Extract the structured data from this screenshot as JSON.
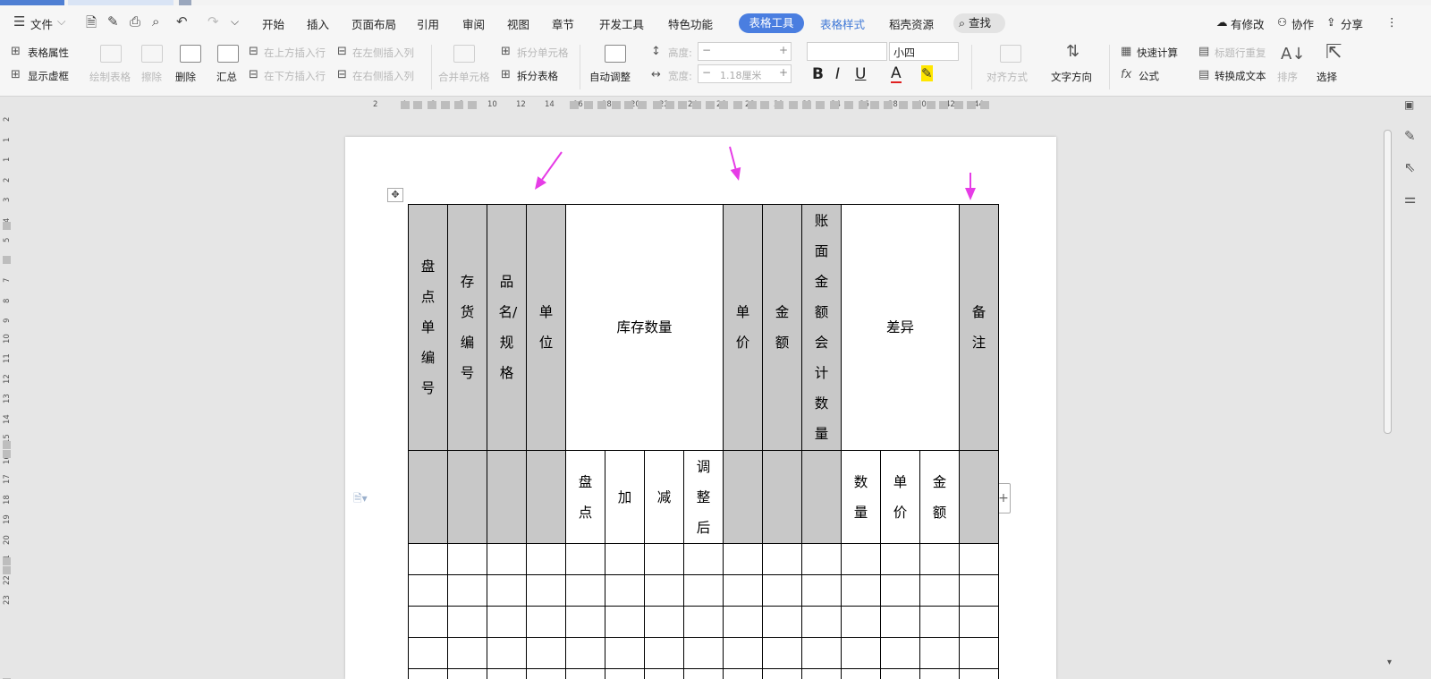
{
  "menu": {
    "file": "文件",
    "tabs": [
      "开始",
      "插入",
      "页面布局",
      "引用",
      "审阅",
      "视图",
      "章节",
      "开发工具",
      "特色功能"
    ],
    "active_tab": "表格工具",
    "extra_tabs": [
      "表格样式",
      "稻壳资源"
    ],
    "search": "查找",
    "right": {
      "modified": "有修改",
      "collab": "协作",
      "share": "分享"
    }
  },
  "ribbon": {
    "table_props": "表格属性",
    "show_grid": "显示虚框",
    "draw_table": "绘制表格",
    "erase": "擦除",
    "delete": "删除",
    "summary": "汇总",
    "insert_above": "在上方插入行",
    "insert_below": "在下方插入行",
    "insert_left": "在左侧插入列",
    "insert_right": "在右侧插入列",
    "merge_cells": "合并单元格",
    "split_cells": "拆分单元格",
    "split_table": "拆分表格",
    "auto_adjust": "自动调整",
    "height_label": "高度:",
    "width_label": "宽度:",
    "width_value": "1.18厘米",
    "font_size": "小四",
    "align": "对齐方式",
    "text_dir": "文字方向",
    "quick_calc": "快速计算",
    "repeat_header": "标题行重复",
    "formula": "公式",
    "to_text": "转换成文本",
    "sort": "排序",
    "select": "选择",
    "bold": "B",
    "italic": "I",
    "underline": "U",
    "font_color": "A"
  },
  "ruler_ticks": [
    "2",
    "4",
    "6",
    "8",
    "10",
    "12",
    "14",
    "16",
    "18",
    "20",
    "22",
    "24",
    "26",
    "28",
    "30",
    "32",
    "34",
    "36",
    "38",
    "40",
    "42",
    "44"
  ],
  "vruler_ticks": [
    "2",
    "1",
    "1",
    "2",
    "3",
    "4",
    "5",
    "6",
    "7",
    "8",
    "9",
    "10",
    "11",
    "12",
    "13",
    "14",
    "15",
    "16",
    "17",
    "18",
    "19",
    "20",
    "21",
    "22",
    "23"
  ],
  "table": {
    "headers": [
      "盘点单编号",
      "存货编号",
      "品名/规格",
      "单位",
      "库存数量",
      "单价",
      "金额",
      "账面金额会计数量",
      "差异",
      "备注"
    ],
    "stock_sub": [
      "盘点",
      "加",
      "减",
      "调整后"
    ],
    "diff_sub": [
      "数量",
      "单价",
      "金额"
    ]
  },
  "colors": {
    "accent": "#4a7ee0",
    "arrow": "#e63ce6",
    "header_fill": "#c8c8c8"
  }
}
